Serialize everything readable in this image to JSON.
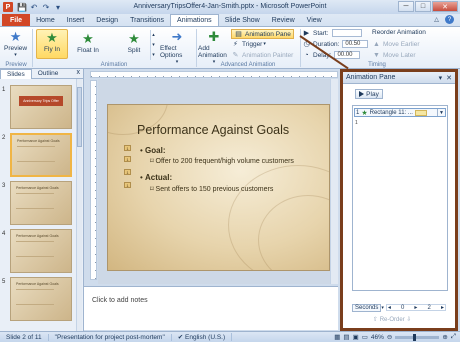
{
  "window": {
    "title": "AnniversaryTripsOffer4-Jan-Smith.pptx - Microsoft PowerPoint",
    "minimize": "─",
    "maximize": "□",
    "close": "✕"
  },
  "qat": {
    "icons": [
      "save-icon",
      "undo-icon",
      "redo-icon",
      "customize-icon"
    ],
    "save": "💾",
    "undo": "↶",
    "redo": "↷",
    "more": "▾"
  },
  "tabs": [
    "File",
    "Home",
    "Insert",
    "Design",
    "Transitions",
    "Animations",
    "Slide Show",
    "Review",
    "View"
  ],
  "active_tab": "Animations",
  "help": {
    "min": "△",
    "q": "?"
  },
  "ribbon": {
    "preview": {
      "label": "Preview",
      "group": "Preview"
    },
    "animation_group": {
      "label": "Animation",
      "items": [
        "Float In",
        "Fly In",
        "Split"
      ],
      "effect_options": "Effect Options",
      "effect_options_arrow": "▾"
    },
    "advanced": {
      "label": "Advanced Animation",
      "add_animation": "Add Animation",
      "add_arrow": "▾",
      "animation_pane": "Animation Pane",
      "trigger": "Trigger",
      "animation_painter": "Animation Painter"
    },
    "timing": {
      "label": "Timing",
      "start_label": "Start:",
      "start_value": "",
      "duration_label": "Duration:",
      "duration_value": "00.50",
      "delay_label": "Delay:",
      "delay_value": "00.00",
      "reorder_title": "Reorder Animation",
      "move_earlier": "Move Earlier",
      "move_later": "Move Later"
    }
  },
  "slides_panel": {
    "tabs": [
      "Slides",
      "Outline"
    ],
    "close": "x",
    "thumbs": [
      {
        "num": "1",
        "title": "Anniversary Trips Offer"
      },
      {
        "num": "2",
        "title": "Performance Against Goals"
      },
      {
        "num": "3",
        "title": "Performance Against Goals"
      },
      {
        "num": "4",
        "title": "Performance Against Goals"
      },
      {
        "num": "5",
        "title": "Performance Against Goals"
      }
    ]
  },
  "slide": {
    "title": "Performance Against Goals",
    "goal_label": "Goal:",
    "goal_text": "Offer to 200 frequent/high volume customers",
    "actual_label": "Actual:",
    "actual_text": "Sent offers to 150 previous customers",
    "marks": [
      "1",
      "1",
      "1",
      "1"
    ]
  },
  "notes": {
    "placeholder": "Click to add notes"
  },
  "animation_pane": {
    "title": "Animation Pane",
    "dropdown": "▾",
    "close": "✕",
    "play": "Play",
    "items": [
      {
        "num": "1",
        "label": "Rectangle 11: ..."
      }
    ],
    "mark": "1",
    "seconds": "Seconds",
    "scale": [
      "0",
      "2"
    ],
    "reorder": "Re-Order"
  },
  "status": {
    "slide": "Slide 2 of 11",
    "theme": "\"Presentation for project post-mortem\"",
    "language": "English (U.S.)",
    "zoom": "46%"
  }
}
